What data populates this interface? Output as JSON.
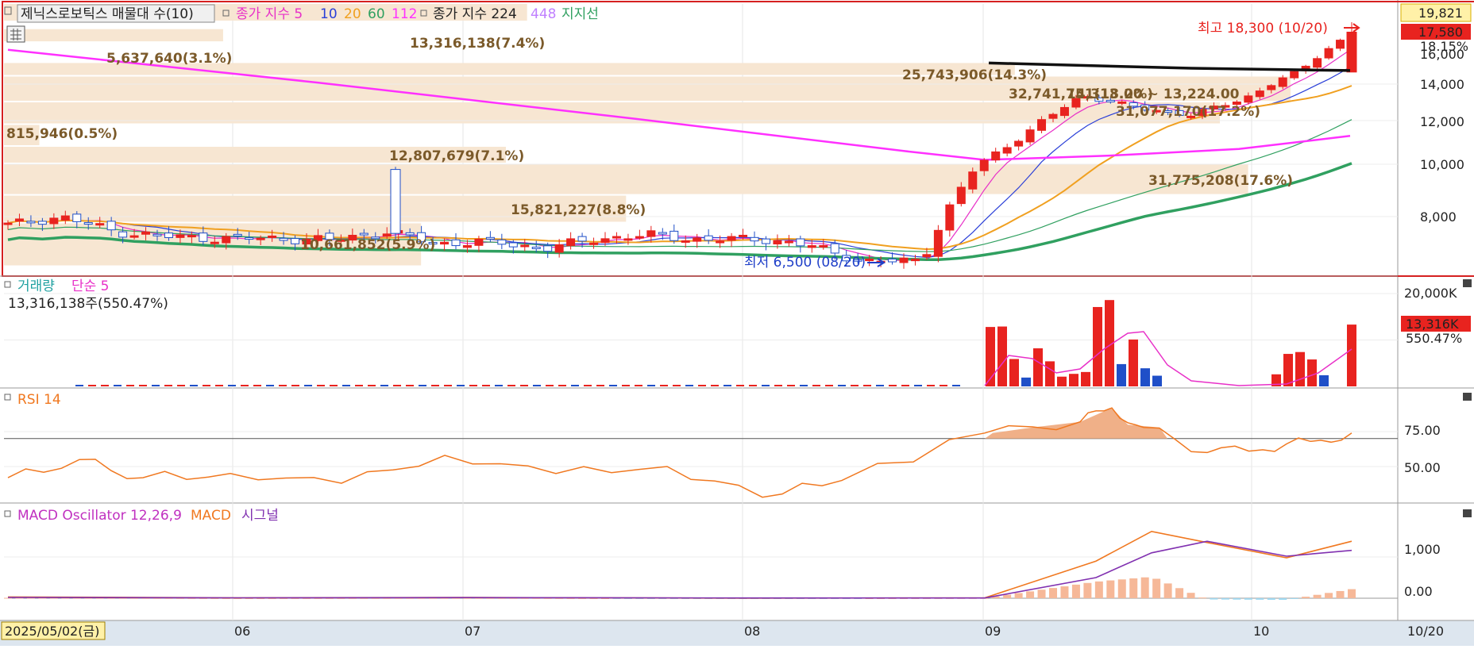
{
  "header": {
    "stock_label": "제닉스로보틱스 매물대 수(10)",
    "ma_label": "종가 지수 5",
    "ma_periods": [
      "10",
      "20",
      "60",
      "112"
    ],
    "ma2_label": "종가 지수 224",
    "ma2_extra": "448",
    "support_label": "지지선"
  },
  "price_axis": {
    "top_box": "19,821",
    "current_box": "17,580",
    "current_change": "18.15%",
    "partial_tick": "16,000",
    "ticks": [
      "14,000",
      "12,000",
      "10,000",
      "8,000"
    ]
  },
  "annotations": {
    "high": "최고 18,300 (10/20)",
    "low": "최저 6,500 (08/20)",
    "range": "14,313.00 ~ 13,224.00"
  },
  "volume_profile": [
    {
      "label": "13,316,138(7.4%)"
    },
    {
      "label": "5,637,640(3.1%)"
    },
    {
      "label": "25,743,906(14.3%)"
    },
    {
      "label": "32,741,751(18.2%)"
    },
    {
      "label": "31,077,170(17.2%)"
    },
    {
      "label": "815,946(0.5%)"
    },
    {
      "label": "12,807,679(7.1%)"
    },
    {
      "label": "31,775,208(17.6%)"
    },
    {
      "label": "15,821,227(8.8%)"
    },
    {
      "label": "10,661,852(5.9%)"
    }
  ],
  "volume_panel": {
    "title": "거래량",
    "ma_label": "단순 5",
    "summary": "13,316,138주(550.47%)",
    "axis_top": "20,000K",
    "current_box": "13,316K",
    "current_pct": "550.47%"
  },
  "rsi_panel": {
    "title": "RSI 14",
    "ticks": [
      "75.00",
      "50.00"
    ]
  },
  "macd_panel": {
    "title_osc": "MACD Oscillator 12,26,9",
    "title_macd": "MACD",
    "title_signal": "시그널",
    "ticks": [
      "1,000",
      "0.00"
    ]
  },
  "date_axis": {
    "start_box": "2025/05/02(금)",
    "months": [
      "06",
      "07",
      "08",
      "09",
      "10"
    ],
    "end_label": "10/20"
  },
  "colors": {
    "up": "#e8231f",
    "down": "#1f4fc8",
    "ma5": "#e830c8",
    "ma10": "#2a3fd8",
    "ma20": "#f0a020",
    "ma60": "#30a060",
    "ma112": "#ff30ff",
    "vp_bar": "#f7e6d2"
  },
  "chart_data": {
    "type": "candlestick",
    "title": "제닉스로보틱스",
    "x_range": [
      "2025-05-02",
      "2025-10-20"
    ],
    "ylim": [
      6000,
      19821
    ],
    "price_high": {
      "date": "2025-10-20",
      "value": 18300
    },
    "price_low": {
      "date": "2025-08-20",
      "value": 6500
    },
    "last_close": 17580,
    "change_pct": 18.15,
    "weekly_close": {
      "dates": [
        "05/02",
        "05/09",
        "05/16",
        "05/23",
        "05/30",
        "06/05",
        "06/13",
        "06/20",
        "06/27",
        "07/04",
        "07/11",
        "07/18",
        "07/25",
        "08/01",
        "08/08",
        "08/14",
        "08/22",
        "08/29",
        "09/05",
        "09/12",
        "09/19",
        "09/26",
        "10/02",
        "10/10",
        "10/17",
        "10/20"
      ],
      "values": [
        7750,
        8000,
        7550,
        7400,
        7350,
        7350,
        7300,
        7550,
        7200,
        7250,
        7050,
        7350,
        7450,
        7300,
        7350,
        7100,
        6650,
        6700,
        9900,
        11500,
        13400,
        12700,
        12300,
        13200,
        14800,
        17580
      ]
    },
    "volume_profile": {
      "axis": "price",
      "bins": [
        {
          "volume": 13316138,
          "pct": 7.4
        },
        {
          "volume": 5637640,
          "pct": 3.1
        },
        {
          "volume": 25743906,
          "pct": 14.3
        },
        {
          "volume": 32741751,
          "pct": 18.2
        },
        {
          "volume": 31077170,
          "pct": 17.2
        },
        {
          "volume": 815946,
          "pct": 0.5
        },
        {
          "volume": 12807679,
          "pct": 7.1
        },
        {
          "volume": 31775208,
          "pct": 17.6
        },
        {
          "volume": 15821227,
          "pct": 8.8
        },
        {
          "volume": 10661852,
          "pct": 5.9
        }
      ]
    },
    "volume": {
      "last": 13316138,
      "last_pct": 550.47,
      "ylim_k": [
        0,
        20000
      ],
      "bars_k": [
        {
          "date": "09/01",
          "value": 12800,
          "dir": "up"
        },
        {
          "date": "09/02",
          "value": 12900,
          "dir": "up"
        },
        {
          "date": "09/03",
          "value": 5900,
          "dir": "up"
        },
        {
          "date": "09/04",
          "value": 1900,
          "dir": "down"
        },
        {
          "date": "09/05",
          "value": 8200,
          "dir": "up"
        },
        {
          "date": "09/08",
          "value": 5400,
          "dir": "up"
        },
        {
          "date": "09/09",
          "value": 2100,
          "dir": "up"
        },
        {
          "date": "09/10",
          "value": 2700,
          "dir": "up"
        },
        {
          "date": "09/11",
          "value": 3100,
          "dir": "up"
        },
        {
          "date": "09/12",
          "value": 17100,
          "dir": "up"
        },
        {
          "date": "09/15",
          "value": 18600,
          "dir": "up"
        },
        {
          "date": "09/16",
          "value": 4800,
          "dir": "down"
        },
        {
          "date": "09/17",
          "value": 10100,
          "dir": "up"
        },
        {
          "date": "09/18",
          "value": 3900,
          "dir": "down"
        },
        {
          "date": "09/19",
          "value": 2300,
          "dir": "down"
        },
        {
          "date": "10/13",
          "value": 2600,
          "dir": "up"
        },
        {
          "date": "10/14",
          "value": 7000,
          "dir": "up"
        },
        {
          "date": "10/15",
          "value": 7400,
          "dir": "up"
        },
        {
          "date": "10/16",
          "value": 5800,
          "dir": "up"
        },
        {
          "date": "10/17",
          "value": 2400,
          "dir": "down"
        },
        {
          "date": "10/20",
          "value": 13316,
          "dir": "up"
        }
      ]
    },
    "rsi": {
      "period": 14,
      "ylim": [
        25,
        100
      ],
      "reference_line": 70,
      "sampled": {
        "dates": [
          "05/02",
          "05/16",
          "05/30",
          "06/13",
          "06/27",
          "07/11",
          "07/25",
          "08/08",
          "08/20",
          "08/29",
          "09/01",
          "09/12",
          "09/15",
          "09/19",
          "10/01",
          "10/10",
          "10/17",
          "10/20"
        ],
        "values": [
          42,
          55,
          42,
          45,
          38,
          58,
          45,
          50,
          28,
          40,
          74,
          82,
          92,
          78,
          60,
          62,
          68,
          74
        ]
      }
    },
    "macd": {
      "params": "12,26,9",
      "ylim": [
        -500,
        2000
      ],
      "sampled_dates": [
        "05/02",
        "06/02",
        "07/01",
        "08/01",
        "08/29",
        "09/12",
        "09/19",
        "10/01",
        "10/10",
        "10/20"
      ],
      "macd": [
        30,
        10,
        20,
        0,
        10,
        900,
        1620,
        1350,
        980,
        1380
      ],
      "signal": [
        20,
        10,
        15,
        5,
        5,
        500,
        1100,
        1380,
        1020,
        1160
      ],
      "oscillator": [
        10,
        0,
        5,
        -5,
        5,
        400,
        520,
        -30,
        -40,
        220
      ]
    }
  }
}
